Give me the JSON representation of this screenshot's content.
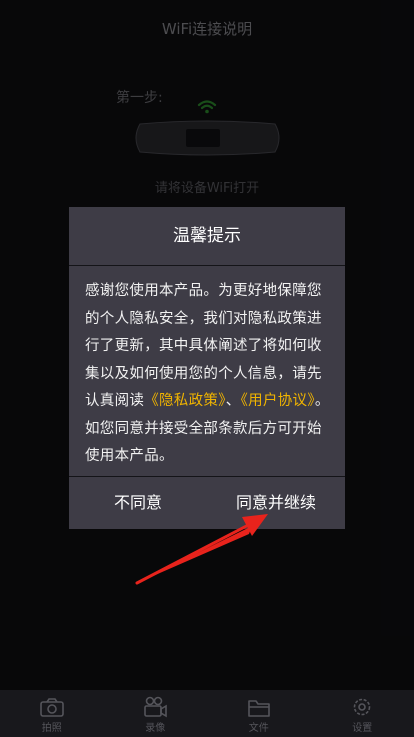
{
  "header": {
    "title": "WiFi连接说明"
  },
  "guide": {
    "step_label": "第一步:",
    "hint": "请将设备WiFi打开"
  },
  "dialog": {
    "title": "温馨提示",
    "body_part1": "感谢您使用本产品。为更好地保障您的个人隐私安全，我们对隐私政策进行了更新，其中具体阐述了将如何收集以及如何使用您的个人信息，请先认真阅读",
    "privacy_link": "《隐私政策》",
    "separator": "、",
    "user_agreement_link": "《用户协议》",
    "body_part2": "。如您同意并接受全部条款后方可开始使用本产品。",
    "disagree_label": "不同意",
    "agree_label": "同意并继续"
  },
  "tabbar": {
    "items": [
      {
        "label": "拍照",
        "icon": "camera-icon"
      },
      {
        "label": "录像",
        "icon": "video-camera-icon"
      },
      {
        "label": "文件",
        "icon": "folder-icon"
      },
      {
        "label": "设置",
        "icon": "gear-icon"
      }
    ]
  },
  "colors": {
    "background": "#0f0f12",
    "dialog": "#3e3c46",
    "link": "#f0b400",
    "arrow": "#e8231c"
  }
}
